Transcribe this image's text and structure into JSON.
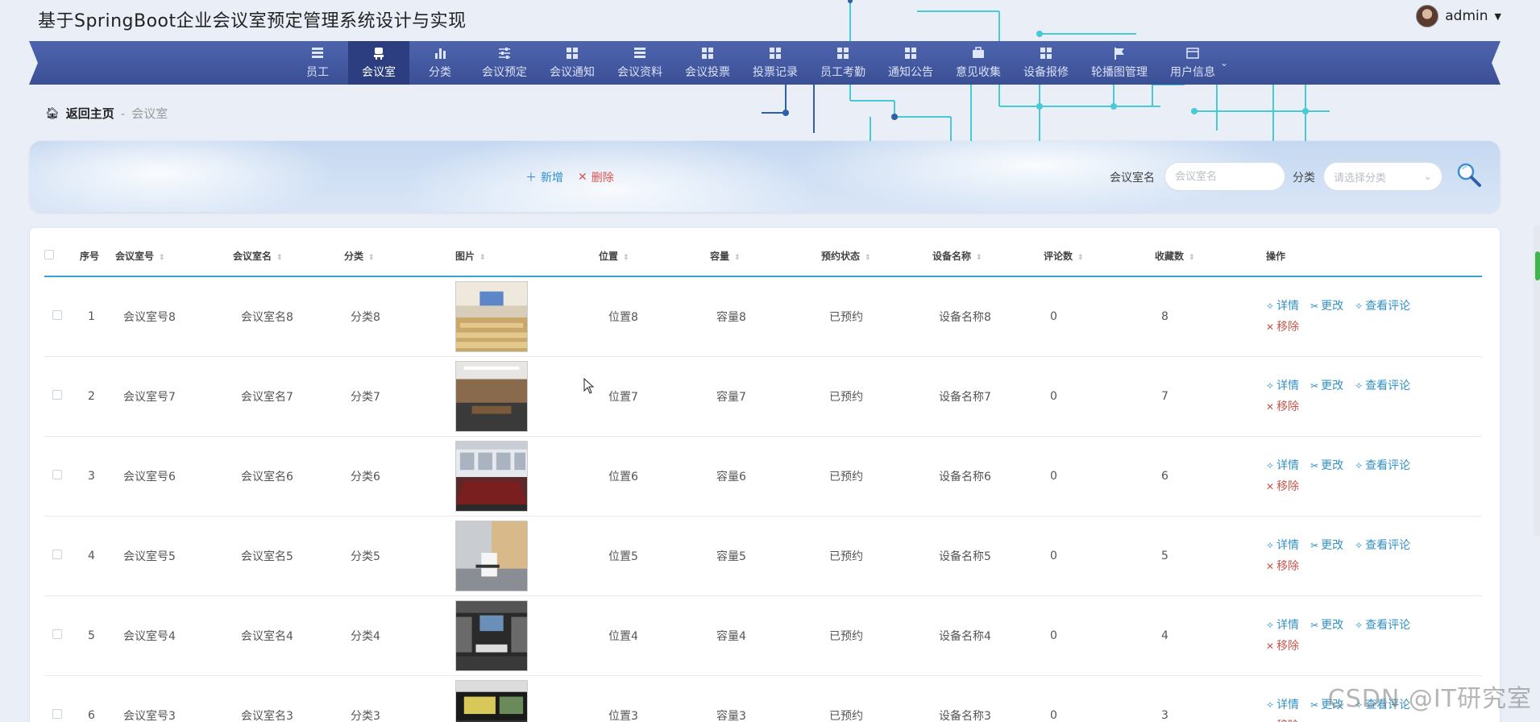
{
  "app": {
    "title": "基于SpringBoot企业会议室预定管理系统设计与实现"
  },
  "user": {
    "name": "admin"
  },
  "nav": {
    "items": [
      {
        "label": "员工",
        "icon": "bars"
      },
      {
        "label": "会议室",
        "icon": "chair",
        "active": true
      },
      {
        "label": "分类",
        "icon": "chart"
      },
      {
        "label": "会议预定",
        "icon": "sliders"
      },
      {
        "label": "会议通知",
        "icon": "grid"
      },
      {
        "label": "会议资料",
        "icon": "bars"
      },
      {
        "label": "会议投票",
        "icon": "grid"
      },
      {
        "label": "投票记录",
        "icon": "grid"
      },
      {
        "label": "员工考勤",
        "icon": "grid"
      },
      {
        "label": "通知公告",
        "icon": "grid"
      },
      {
        "label": "意见收集",
        "icon": "briefcase"
      },
      {
        "label": "设备报修",
        "icon": "grid"
      },
      {
        "label": "轮播图管理",
        "icon": "flag"
      },
      {
        "label": "用户信息",
        "icon": "window"
      }
    ]
  },
  "breadcrumb": {
    "home": "返回主页",
    "sep": "-",
    "current": "会议室"
  },
  "toolbar": {
    "add": "新增",
    "delete": "删除"
  },
  "search": {
    "name_label": "会议室名",
    "name_placeholder": "会议室名",
    "category_label": "分类",
    "category_placeholder": "请选择分类"
  },
  "table": {
    "columns": [
      "序号",
      "会议室号",
      "会议室名",
      "分类",
      "图片",
      "位置",
      "容量",
      "预约状态",
      "设备名称",
      "评论数",
      "收藏数",
      "操作"
    ],
    "actions": {
      "detail": "详情",
      "edit": "更改",
      "comments": "查看评论",
      "remove": "移除"
    },
    "rows": [
      {
        "no": "1",
        "room_no": "会议室号8",
        "room_name": "会议室名8",
        "category": "分类8",
        "location": "位置8",
        "capacity": "容量8",
        "status": "已预约",
        "device": "设备名称8",
        "comments": "0",
        "favorites": "8",
        "img": "auditorium"
      },
      {
        "no": "2",
        "room_no": "会议室号7",
        "room_name": "会议室名7",
        "category": "分类7",
        "location": "位置7",
        "capacity": "容量7",
        "status": "已预约",
        "device": "设备名称7",
        "comments": "0",
        "favorites": "7",
        "img": "boardroom-wood"
      },
      {
        "no": "3",
        "room_no": "会议室号6",
        "room_name": "会议室名6",
        "category": "分类6",
        "location": "位置6",
        "capacity": "容量6",
        "status": "已预约",
        "device": "设备名称6",
        "comments": "0",
        "favorites": "6",
        "img": "long-table"
      },
      {
        "no": "4",
        "room_no": "会议室号5",
        "room_name": "会议室名5",
        "category": "分类5",
        "location": "位置5",
        "capacity": "容量5",
        "status": "已预约",
        "device": "设备名称5",
        "comments": "0",
        "favorites": "5",
        "img": "small-room"
      },
      {
        "no": "5",
        "room_no": "会议室号4",
        "room_name": "会议室名4",
        "category": "分类4",
        "location": "位置4",
        "capacity": "容量4",
        "status": "已预约",
        "device": "设备名称4",
        "comments": "0",
        "favorites": "4",
        "img": "dark-room"
      },
      {
        "no": "6",
        "room_no": "会议室号3",
        "room_name": "会议室名3",
        "category": "分类3",
        "location": "位置3",
        "capacity": "容量3",
        "status": "已预约",
        "device": "设备名称3",
        "comments": "0",
        "favorites": "3",
        "img": "office-room"
      }
    ]
  },
  "watermark": "CSDN @IT研究室",
  "colors": {
    "nav_bg": "#3b4f96",
    "nav_active": "#2c3d80",
    "accent": "#3391c4",
    "danger": "#c9574e",
    "header_line": "#3aa0d8"
  }
}
